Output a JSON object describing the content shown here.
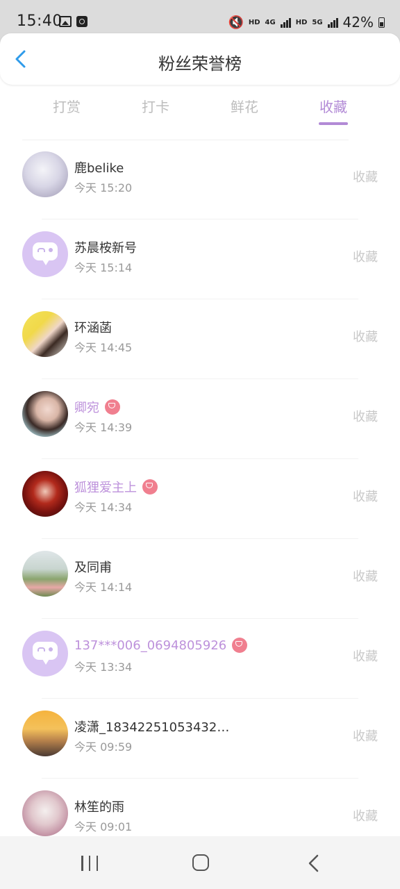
{
  "status_bar": {
    "time": "15:40",
    "net1": "HD",
    "net2": "4G",
    "net3": "HD",
    "net4": "5G",
    "battery": "42%"
  },
  "header": {
    "title": "粉丝荣誉榜",
    "back_icon": "chevron-left-icon"
  },
  "tabs": [
    {
      "label": "打赏",
      "active": false
    },
    {
      "label": "打卡",
      "active": false
    },
    {
      "label": "鲜花",
      "active": false
    },
    {
      "label": "收藏",
      "active": true
    }
  ],
  "colors": {
    "accent": "#b28ad6",
    "vip_name": "#bd91db",
    "vip_badge": "#f07f8f",
    "back_icon": "#2f9bea"
  },
  "list": [
    {
      "name": "鹿belike",
      "time": "今天 15:20",
      "action": "收藏",
      "vip": false,
      "avatar": "photo"
    },
    {
      "name": "苏晨桉新号",
      "time": "今天 15:14",
      "action": "收藏",
      "vip": false,
      "avatar": "default"
    },
    {
      "name": "环涵菡",
      "time": "今天 14:45",
      "action": "收藏",
      "vip": false,
      "avatar": "photo"
    },
    {
      "name": "卿宛",
      "time": "今天 14:39",
      "action": "收藏",
      "vip": true,
      "avatar": "photo"
    },
    {
      "name": "狐狸爱主上",
      "time": "今天 14:34",
      "action": "收藏",
      "vip": true,
      "avatar": "photo"
    },
    {
      "name": "及同甫",
      "time": "今天 14:14",
      "action": "收藏",
      "vip": false,
      "avatar": "photo"
    },
    {
      "name": "137***006_0694805926",
      "time": "今天 13:34",
      "action": "收藏",
      "vip": true,
      "avatar": "default"
    },
    {
      "name": "凌潇_18342251053432…",
      "time": "今天 09:59",
      "action": "收藏",
      "vip": false,
      "avatar": "photo"
    },
    {
      "name": "林笙的雨",
      "time": "今天 09:01",
      "action": "收藏",
      "vip": false,
      "avatar": "photo"
    }
  ],
  "navbar": {
    "recents_icon": "recents-icon",
    "home_icon": "home-icon",
    "back_icon": "back-icon"
  }
}
